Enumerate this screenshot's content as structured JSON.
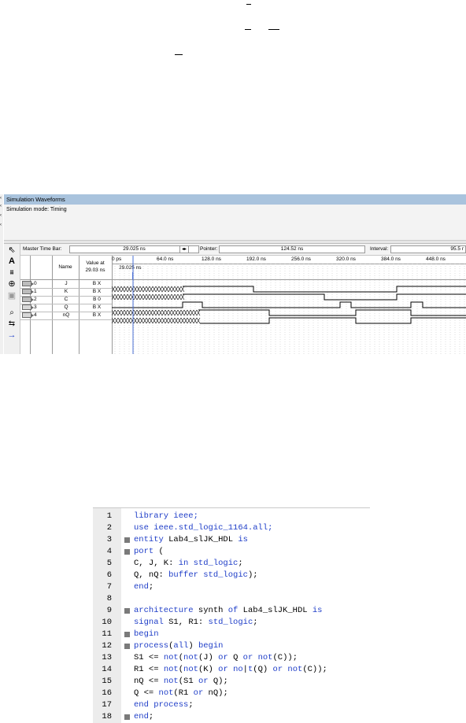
{
  "simulation": {
    "title": "Simulation Waveforms",
    "mode": "Simulation mode: Timing",
    "master_time_bar_label": "Master Time Bar:",
    "master_time_bar_value": "29.025 ns",
    "pointer_label": "Pointer:",
    "pointer_value": "124.52 ns",
    "interval_label": "Interval:",
    "interval_value": "95.5 r",
    "columns": {
      "name": "Name",
      "value_at_line1": "Value at",
      "value_at_line2": "29.03 ns"
    },
    "cursor_label": "29.025 ns",
    "time_ticks": [
      "0 ps",
      "64.0 ns",
      "128.0 ns",
      "192.0 ns",
      "256.0 ns",
      "320.0 ns",
      "384.0 ns",
      "448.0 ns"
    ],
    "signals": [
      {
        "index": "0",
        "name": "J",
        "value": "B X",
        "direction": "input"
      },
      {
        "index": "1",
        "name": "K",
        "value": "B X",
        "direction": "input"
      },
      {
        "index": "2",
        "name": "C",
        "value": "B 0",
        "direction": "input"
      },
      {
        "index": "3",
        "name": "Q",
        "value": "B X",
        "direction": "output"
      },
      {
        "index": "4",
        "name": "nQ",
        "value": "B X",
        "direction": "output"
      }
    ],
    "toolbar_icons": [
      "pointer-icon",
      "text-tool-icon",
      "waveform-editing-icon",
      "zoom-icon",
      "full-screen-icon",
      "find-icon",
      "replace-icon",
      "arrow-icon"
    ]
  },
  "editor": {
    "lines": [
      {
        "n": "1",
        "fold": false,
        "parts": [
          [
            "kw",
            "library ieee;"
          ]
        ]
      },
      {
        "n": "2",
        "fold": false,
        "parts": [
          [
            "kw",
            "use ieee.std_logic_1164.all;"
          ]
        ]
      },
      {
        "n": "3",
        "fold": true,
        "parts": [
          [
            "kw",
            "entity "
          ],
          [
            "tx",
            "Lab4_slJK_HDL "
          ],
          [
            "kw",
            "is"
          ]
        ]
      },
      {
        "n": "4",
        "fold": true,
        "parts": [
          [
            "kw",
            "port"
          ],
          [
            "tx",
            " ("
          ]
        ]
      },
      {
        "n": "5",
        "fold": false,
        "parts": [
          [
            "tx",
            "C, J, K: "
          ],
          [
            "kw",
            "in std_logic"
          ],
          [
            "tx",
            ";"
          ]
        ]
      },
      {
        "n": "6",
        "fold": false,
        "parts": [
          [
            "tx",
            "Q, nQ: "
          ],
          [
            "kw",
            "buffer std_logic"
          ],
          [
            "tx",
            ");"
          ]
        ]
      },
      {
        "n": "7",
        "fold": false,
        "parts": [
          [
            "kw",
            "end"
          ],
          [
            "tx",
            ";"
          ]
        ]
      },
      {
        "n": "8",
        "fold": false,
        "parts": []
      },
      {
        "n": "9",
        "fold": true,
        "parts": [
          [
            "kw",
            "architecture "
          ],
          [
            "tx",
            "synth "
          ],
          [
            "kw",
            "of "
          ],
          [
            "tx",
            "Lab4_slJK_HDL "
          ],
          [
            "kw",
            "is"
          ]
        ]
      },
      {
        "n": "10",
        "fold": false,
        "parts": [
          [
            "kw",
            "signal "
          ],
          [
            "tx",
            "S1, R1: "
          ],
          [
            "kw",
            "std_logic"
          ],
          [
            "tx",
            ";"
          ]
        ]
      },
      {
        "n": "11",
        "fold": true,
        "parts": [
          [
            "kw",
            "begin"
          ]
        ]
      },
      {
        "n": "12",
        "fold": true,
        "parts": [
          [
            "kw",
            "process"
          ],
          [
            "tx",
            "("
          ],
          [
            "kw",
            "all"
          ],
          [
            "tx",
            ") "
          ],
          [
            "kw",
            "begin"
          ]
        ]
      },
      {
        "n": "13",
        "fold": false,
        "parts": [
          [
            "tx",
            "S1 <= "
          ],
          [
            "kw",
            "not"
          ],
          [
            "tx",
            "("
          ],
          [
            "kw",
            "not"
          ],
          [
            "tx",
            "(J) "
          ],
          [
            "kw",
            "or "
          ],
          [
            "tx",
            "Q "
          ],
          [
            "kw",
            "or not"
          ],
          [
            "tx",
            "(C));"
          ]
        ]
      },
      {
        "n": "14",
        "fold": false,
        "parts": [
          [
            "tx",
            "R1 <= "
          ],
          [
            "kw",
            "not"
          ],
          [
            "tx",
            "("
          ],
          [
            "kw",
            "not"
          ],
          [
            "tx",
            "(K) "
          ],
          [
            "kw",
            "or "
          ],
          [
            "kw",
            "no"
          ],
          [
            "tx",
            "|"
          ],
          [
            "kw",
            "t"
          ],
          [
            "tx",
            "(Q) "
          ],
          [
            "kw",
            "or not"
          ],
          [
            "tx",
            "(C));"
          ]
        ]
      },
      {
        "n": "15",
        "fold": false,
        "parts": [
          [
            "tx",
            "nQ <= "
          ],
          [
            "kw",
            "not"
          ],
          [
            "tx",
            "(S1 "
          ],
          [
            "kw",
            "or "
          ],
          [
            "tx",
            "Q);"
          ]
        ]
      },
      {
        "n": "16",
        "fold": false,
        "parts": [
          [
            "tx",
            "Q <= "
          ],
          [
            "kw",
            "not"
          ],
          [
            "tx",
            "(R1 "
          ],
          [
            "kw",
            "or "
          ],
          [
            "tx",
            "nQ);"
          ]
        ]
      },
      {
        "n": "17",
        "fold": false,
        "parts": [
          [
            "kw",
            "end process"
          ],
          [
            "tx",
            ";"
          ]
        ]
      },
      {
        "n": "18",
        "fold": true,
        "parts": [
          [
            "kw",
            "end"
          ],
          [
            "tx",
            ";"
          ]
        ]
      }
    ]
  },
  "colors": {
    "titlebar": "#a9c3dd",
    "keyword": "#1f3ec8",
    "cursor": "#4a6fd6"
  }
}
